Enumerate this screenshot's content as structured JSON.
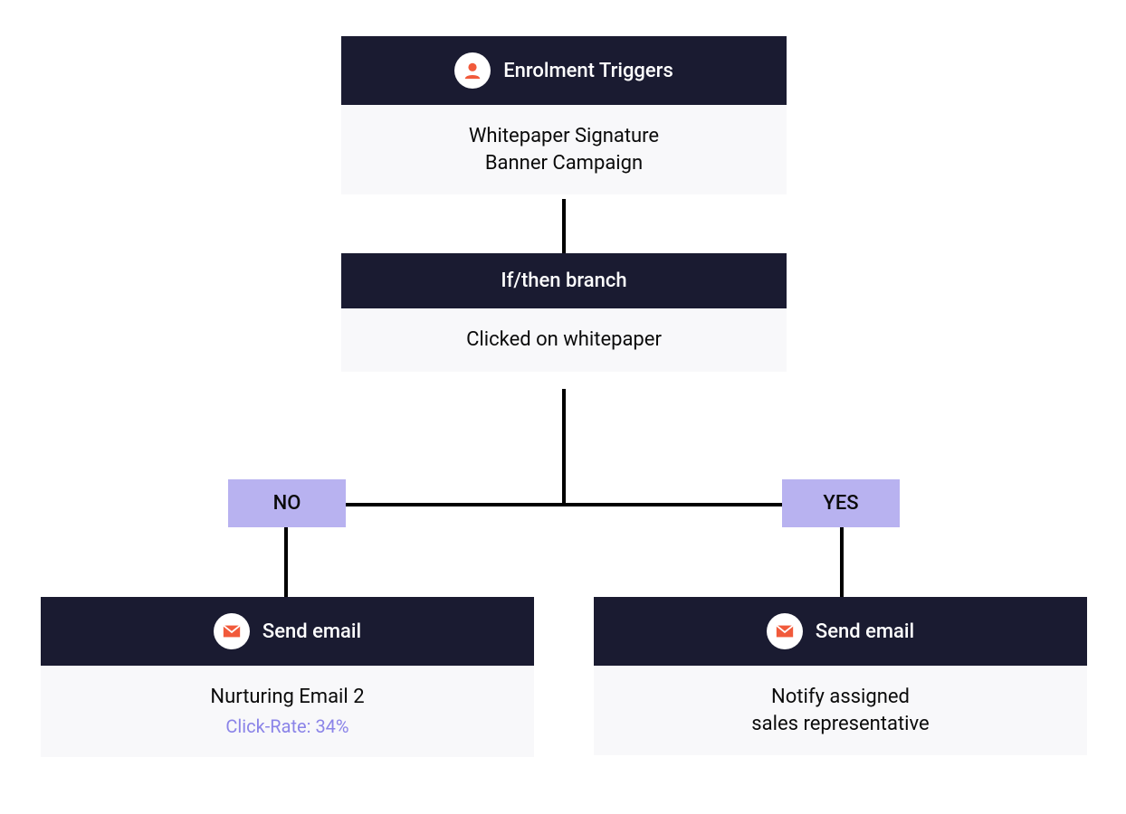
{
  "node1": {
    "title": "Enrolment Triggers",
    "body_line1": "Whitepaper Signature",
    "body_line2": "Banner Campaign"
  },
  "node2": {
    "title": "If/then branch",
    "body": "Clicked on whitepaper"
  },
  "branch": {
    "no_label": "NO",
    "yes_label": "YES"
  },
  "node_no": {
    "title": "Send email",
    "body": "Nurturing Email 2",
    "metric": "Click-Rate: 34%"
  },
  "node_yes": {
    "title": "Send email",
    "body_line1": "Notify assigned",
    "body_line2": "sales representative"
  }
}
